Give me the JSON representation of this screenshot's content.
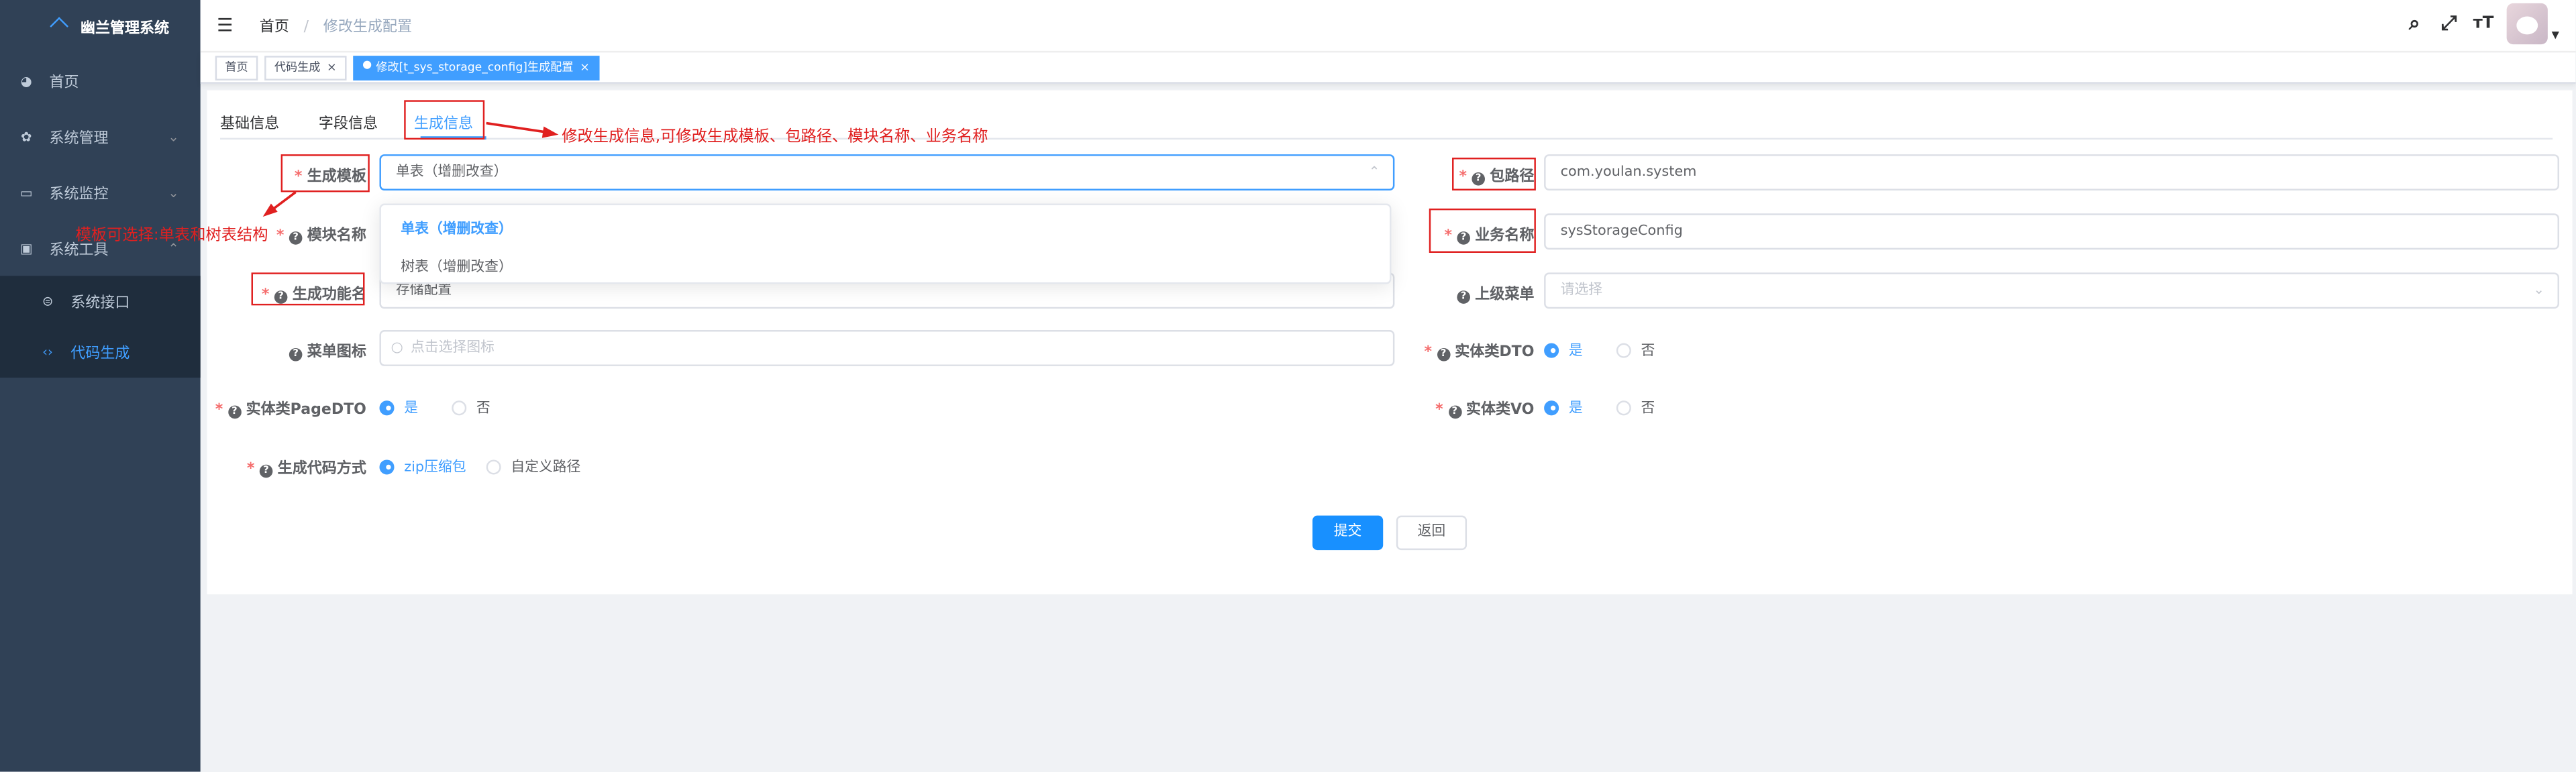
{
  "app": {
    "title": "幽兰管理系统"
  },
  "sidebar": {
    "items": [
      {
        "label": "首页",
        "icon": "dashboard-icon"
      },
      {
        "label": "系统管理",
        "icon": "gear-icon"
      },
      {
        "label": "系统监控",
        "icon": "monitor-icon"
      },
      {
        "label": "系统工具",
        "icon": "toolbox-icon"
      }
    ],
    "sub_items": [
      {
        "label": "系统接口",
        "icon": "api-icon"
      },
      {
        "label": "代码生成",
        "icon": "code-icon"
      }
    ]
  },
  "breadcrumb": {
    "home": "首页",
    "separator": "/",
    "current": "修改生成配置"
  },
  "tags": [
    {
      "label": "首页"
    },
    {
      "label": "代码生成"
    },
    {
      "label": "修改[t_sys_storage_config]生成配置"
    }
  ],
  "tabs": [
    "基础信息",
    "字段信息",
    "生成信息"
  ],
  "form": {
    "tpl_label": "生成模板",
    "tpl_value": "单表（增删改查）",
    "module_label": "模块名称",
    "func_label": "生成功能名",
    "func_value": "存储配置",
    "icon_label": "菜单图标",
    "icon_placeholder": "点击选择图标",
    "pagedto_label": "实体类PageDTO",
    "gentype_label": "生成代码方式",
    "gentype_zip": "zip压缩包",
    "gentype_custom": "自定义路径",
    "pkg_label": "包路径",
    "pkg_value": "com.youlan.system",
    "biz_label": "业务名称",
    "biz_value": "sysStorageConfig",
    "parent_label": "上级菜单",
    "parent_placeholder": "请选择",
    "dto_label": "实体类DTO",
    "vo_label": "实体类VO",
    "yes": "是",
    "no": "否",
    "submit": "提交",
    "back": "返回"
  },
  "dropdown": {
    "options": [
      "单表（增删改查）",
      "树表（增删改查）"
    ]
  },
  "annotations": {
    "tab_note": "修改生成信息,可修改生成模板、包路径、模块名称、业务名称",
    "tpl_note": "模板可选择:单表和树表结构"
  },
  "colors": {
    "sidebar": "#304156",
    "accent": "#409eff",
    "annotation": "#e02020"
  }
}
